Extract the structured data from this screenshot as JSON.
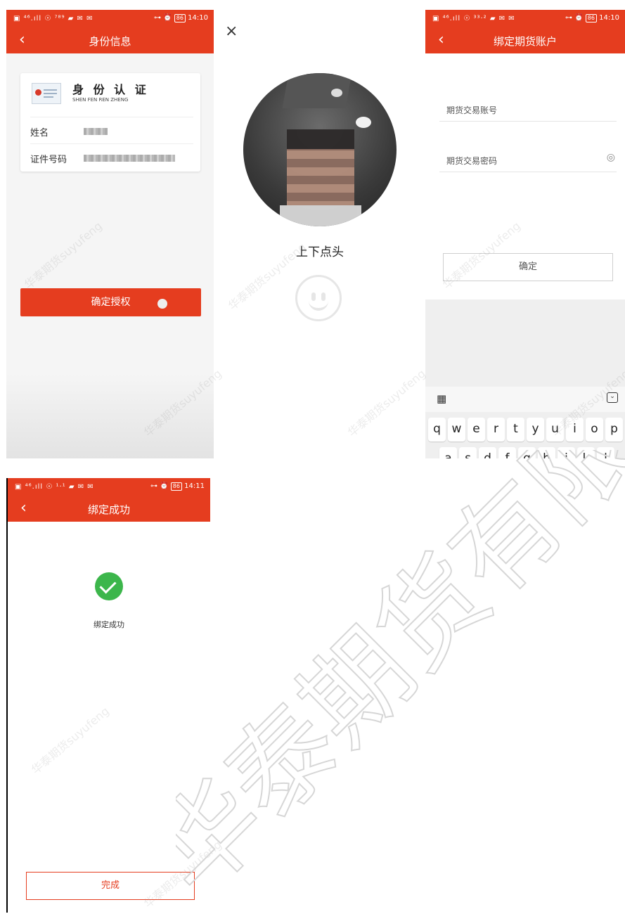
{
  "panel1": {
    "status": {
      "left": "▣ ⁴⁶.ıll ☉ ⁷⁸⁹ ▰ ✉ ✉",
      "time": "14:10",
      "battery": "86"
    },
    "title": "身份信息",
    "card": {
      "heading": "身 份 认 证",
      "subheading": "SHEN FEN REN ZHENG",
      "name_label": "姓名",
      "id_label": "证件号码"
    },
    "confirm_button": "确定授权"
  },
  "panel2": {
    "close": "×",
    "prompt": "上下点头"
  },
  "panel3": {
    "status": {
      "left": "▣ ⁴⁶.ıll ☉ ³³·² ▰ ✉ ✉",
      "time": "14:10",
      "battery": "86"
    },
    "title": "绑定期货账户",
    "account_placeholder": "期货交易账号",
    "password_placeholder": "期货交易密码",
    "confirm_button": "确定",
    "keyboard": {
      "row1": [
        "q",
        "w",
        "e",
        "r",
        "t",
        "y",
        "u",
        "i",
        "o",
        "p"
      ],
      "row2": [
        "a",
        "s",
        "d",
        "f",
        "g",
        "h",
        "j",
        "k",
        "l"
      ]
    }
  },
  "panel4": {
    "status": {
      "left": "▣ ⁴⁶.ıll ☉ ¹·¹ ▰ ✉ ✉",
      "time": "14:11",
      "battery": "86"
    },
    "title": "绑定成功",
    "message": "绑定成功",
    "done_button": "完成"
  },
  "watermark": {
    "small": "华泰期货suyufeng",
    "large": "华泰期货有限公司"
  },
  "colors": {
    "brand": "#e53d1f",
    "success": "#3cb64b"
  }
}
